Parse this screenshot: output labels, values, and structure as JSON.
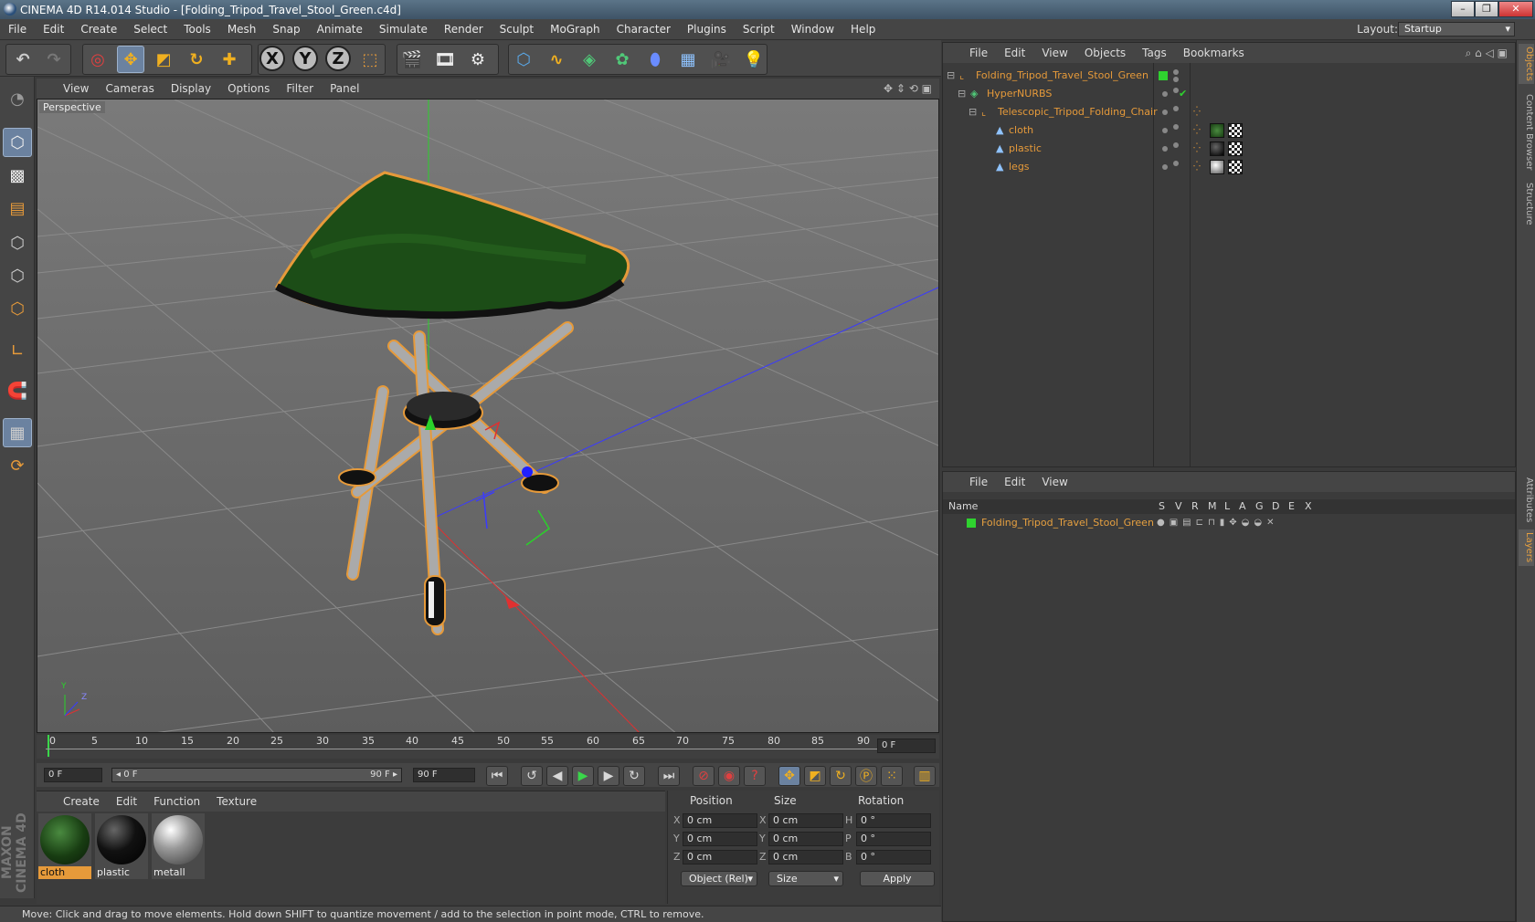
{
  "window": {
    "title": "CINEMA 4D R14.014 Studio - [Folding_Tripod_Travel_Stool_Green.c4d]",
    "minimize_glyph": "–",
    "maximize_glyph": "❐",
    "close_glyph": "✕"
  },
  "menubar": {
    "items": [
      "File",
      "Edit",
      "Create",
      "Select",
      "Tools",
      "Mesh",
      "Snap",
      "Animate",
      "Simulate",
      "Render",
      "Sculpt",
      "MoGraph",
      "Character",
      "Plugins",
      "Script",
      "Window",
      "Help"
    ],
    "layout_label": "Layout:",
    "layout_value": "Startup"
  },
  "toolbar": {
    "axis_x": "X",
    "axis_y": "Y",
    "axis_z": "Z"
  },
  "viewport": {
    "menu": [
      "View",
      "Cameras",
      "Display",
      "Options",
      "Filter",
      "Panel"
    ],
    "label": "Perspective",
    "axis_y": "Y",
    "axis_z": "Z"
  },
  "timeline": {
    "ticks": [
      "0",
      "5",
      "10",
      "15",
      "20",
      "25",
      "30",
      "35",
      "40",
      "45",
      "50",
      "55",
      "60",
      "65",
      "70",
      "75",
      "80",
      "85",
      "90"
    ],
    "current_frame": "0 F",
    "start_field": "0 F",
    "range_start": "◂ 0 F",
    "range_end": "90 F ▸",
    "end_field": "90 F"
  },
  "materials": {
    "menu": [
      "Create",
      "Edit",
      "Function",
      "Texture"
    ],
    "items": [
      {
        "name": "cloth"
      },
      {
        "name": "plastic"
      },
      {
        "name": "metall"
      }
    ]
  },
  "coordinates": {
    "headers": {
      "position": "Position",
      "size": "Size",
      "rotation": "Rotation"
    },
    "rows": [
      {
        "axis": "X",
        "pos": "0 cm",
        "size_axis": "X",
        "size": "0 cm",
        "rot_axis": "H",
        "rot": "0 °"
      },
      {
        "axis": "Y",
        "pos": "0 cm",
        "size_axis": "Y",
        "size": "0 cm",
        "rot_axis": "P",
        "rot": "0 °"
      },
      {
        "axis": "Z",
        "pos": "0 cm",
        "size_axis": "Z",
        "size": "0 cm",
        "rot_axis": "B",
        "rot": "0 °"
      }
    ],
    "mode": "Object (Rel)",
    "size_mode": "Size",
    "apply": "Apply"
  },
  "status": "Move: Click and drag to move elements. Hold down SHIFT to quantize movement / add to the selection in point mode, CTRL to remove.",
  "object_manager": {
    "menu": [
      "File",
      "Edit",
      "View",
      "Objects",
      "Tags",
      "Bookmarks"
    ],
    "objects": [
      {
        "name": "Folding_Tripod_Travel_Stool_Green"
      },
      {
        "name": "HyperNURBS"
      },
      {
        "name": "Telescopic_Tripod_Folding_Chair"
      },
      {
        "name": "cloth"
      },
      {
        "name": "plastic"
      },
      {
        "name": "legs"
      }
    ]
  },
  "layer_manager": {
    "menu": [
      "File",
      "Edit",
      "View"
    ],
    "columns": {
      "name": "Name",
      "flags": [
        "S",
        "V",
        "R",
        "M",
        "L",
        "A",
        "G",
        "D",
        "E",
        "X"
      ]
    },
    "layers": [
      {
        "name": "Folding_Tripod_Travel_Stool_Green"
      }
    ]
  },
  "right_tabs": [
    "Objects",
    "Content Browser",
    "Structure",
    "Attributes",
    "Layers"
  ],
  "brand": "MAXON CINEMA 4D",
  "colors": {
    "accent": "#e69a3a",
    "selected_tool": "#6b82a0",
    "layer_green": "#2fd22f"
  }
}
